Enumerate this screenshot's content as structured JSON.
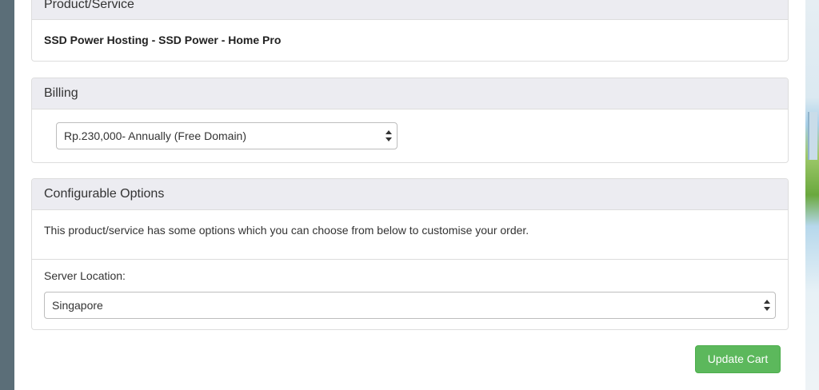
{
  "product_panel": {
    "heading": "Product/Service",
    "product_name": "SSD Power Hosting - SSD Power - Home Pro"
  },
  "billing_panel": {
    "heading": "Billing",
    "selected_cycle": "Rp.230,000- Annually (Free Domain)"
  },
  "config_panel": {
    "heading": "Configurable Options",
    "description": "This product/service has some options which you can choose from below to customise your order.",
    "server_location_label": "Server Location:",
    "server_location_value": "Singapore"
  },
  "actions": {
    "update_cart_label": "Update Cart"
  },
  "colors": {
    "panel_heading_bg": "#ececf1",
    "button_green": "#5cb85c",
    "left_strip": "#5b6e78"
  }
}
